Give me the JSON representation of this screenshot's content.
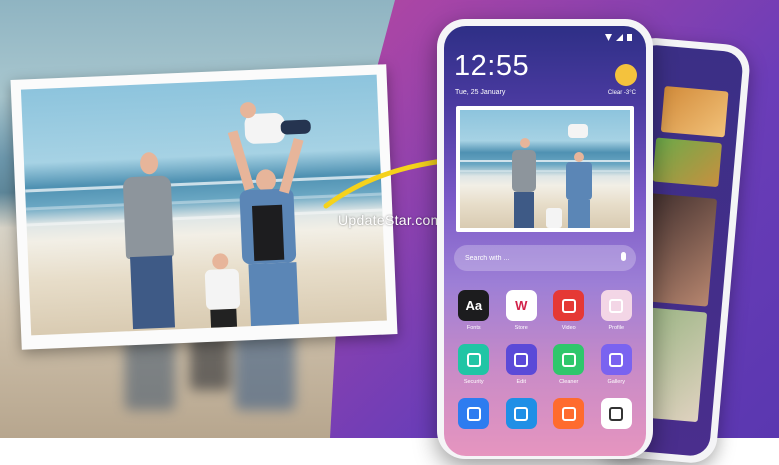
{
  "watermark": "UpdateStar.com",
  "phone": {
    "time": "12:55",
    "date": "Tue, 25 January",
    "weather": "Clear -3°C",
    "search_placeholder": "Search with ...",
    "apps": [
      {
        "label": "Fonts",
        "icon": "fonts-icon",
        "text": "Aa",
        "color": "#1c1c1e"
      },
      {
        "label": "Store",
        "icon": "store-icon",
        "text": "W",
        "color": "#ffffff"
      },
      {
        "label": "Video",
        "icon": "video-icon",
        "text": "",
        "color": "#e53935"
      },
      {
        "label": "Profile",
        "icon": "profile-icon",
        "text": "",
        "color": "#f3d6e6"
      },
      {
        "label": "Security",
        "icon": "security-icon",
        "text": "",
        "color": "#20c5a5"
      },
      {
        "label": "Edit",
        "icon": "edit-icon",
        "text": "",
        "color": "#5b4ad8"
      },
      {
        "label": "Cleaner",
        "icon": "cleaner-icon",
        "text": "",
        "color": "#2fc76c"
      },
      {
        "label": "Gallery",
        "icon": "gallery-icon",
        "text": "",
        "color": "#7a63f0"
      },
      {
        "label": "",
        "icon": "play-icon",
        "text": "",
        "color": "#2d7cf0"
      },
      {
        "label": "",
        "icon": "cast-icon",
        "text": "",
        "color": "#1f8fe6"
      },
      {
        "label": "",
        "icon": "camera-icon",
        "text": "",
        "color": "#ff6b2e"
      },
      {
        "label": "",
        "icon": "filter-icon",
        "text": "",
        "color": "#ffffff"
      }
    ]
  }
}
